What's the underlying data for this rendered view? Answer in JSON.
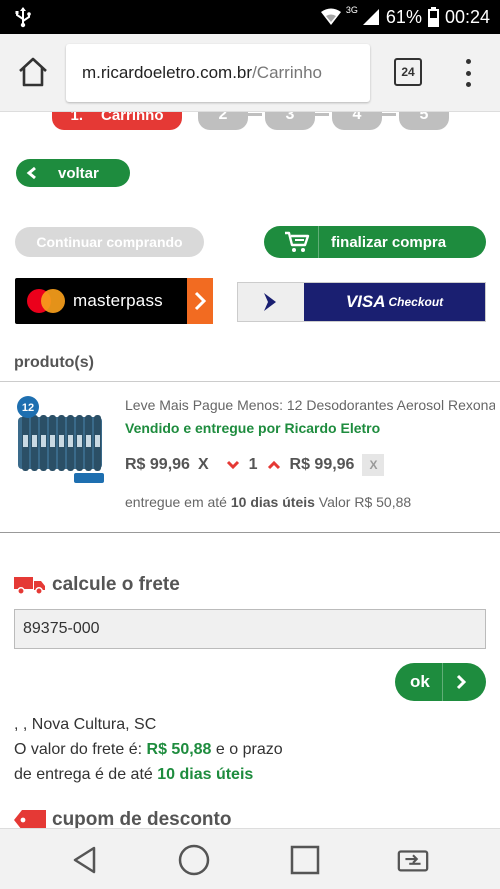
{
  "status_bar": {
    "network": "3G",
    "battery": "61%",
    "time": "00:24"
  },
  "browser": {
    "url_domain": "m.ricardoeletro.com.br",
    "url_path": "/Carrinho",
    "tabs_count": "24"
  },
  "steps": {
    "active": {
      "number": "1.",
      "label": "Carrinho"
    },
    "others": [
      "2",
      "3",
      "4",
      "5"
    ]
  },
  "buttons": {
    "voltar": "voltar",
    "continuar": "Continuar comprando",
    "finalizar": "finalizar compra",
    "masterpass": "masterpass",
    "visa_brand": "VISA",
    "visa_checkout": "Checkout",
    "ok": "ok"
  },
  "products_section": {
    "label": "produto(s)",
    "items": [
      {
        "name": "Leve Mais Pague Menos: 12 Desodorantes Aerosol Rexona",
        "sold_by": "Vendido e entregue por  Ricardo Eletro",
        "unit_price": "R$ 99,96",
        "times": "X",
        "quantity": "1",
        "total_price": "R$ 99,96",
        "remove": "X",
        "delivery_prefix": "entregue em até ",
        "delivery_days": "10 dias úteis",
        "delivery_value": " Valor R$ 50,88",
        "badge_count": "12"
      }
    ]
  },
  "frete": {
    "title": "calcule o frete",
    "cep_value": "89375-000",
    "address": ", , Nova Cultura, SC",
    "line2_prefix": "O valor do frete é: ",
    "value": "R$ 50,88",
    "line2_suffix": " e o prazo",
    "line3_prefix": "de entrega é de até ",
    "days": "10 dias úteis"
  },
  "cupom": {
    "title": "cupom de desconto"
  },
  "colors": {
    "green": "#1e8c3e",
    "red": "#e53935",
    "orange": "#f26b21",
    "visa_blue": "#1a1f71"
  }
}
